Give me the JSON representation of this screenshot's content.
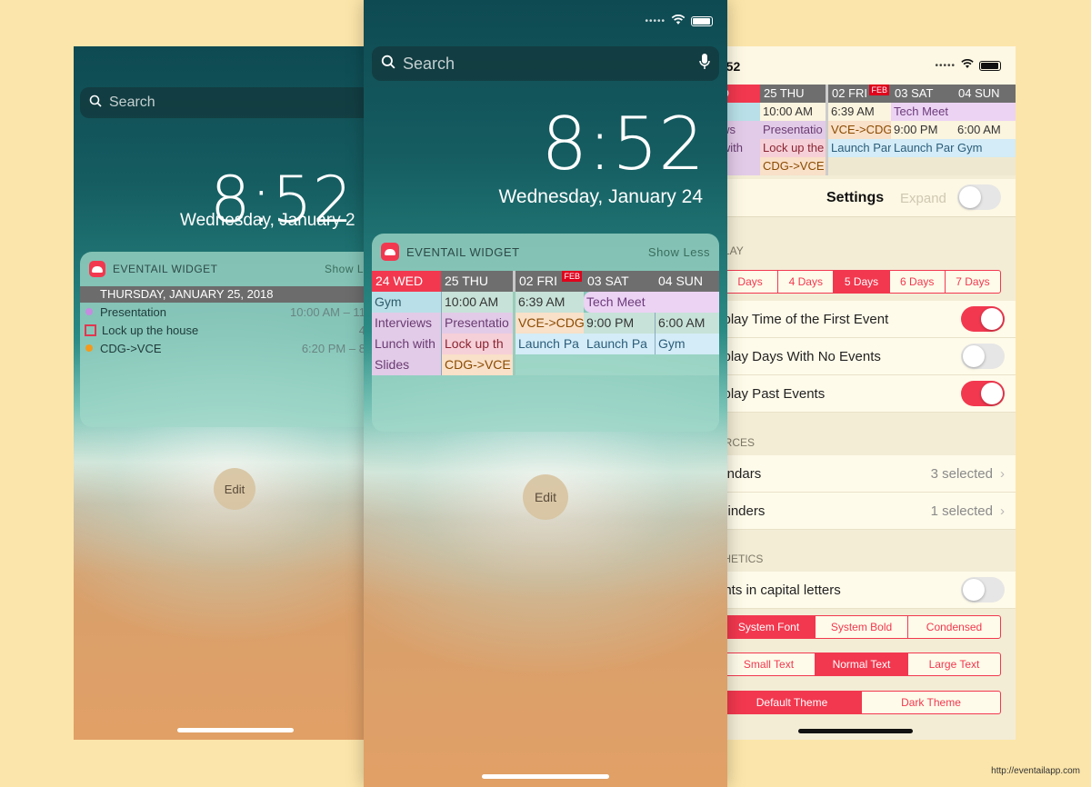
{
  "left": {
    "search": "Search",
    "time": "8:52",
    "date": "Wednesday, January 2",
    "widget": {
      "title": "EVENTAIL WIDGET",
      "action": "Show L",
      "day_header": "THURSDAY, JANUARY 25, 2018",
      "events": [
        {
          "label": "Presentation",
          "time": "10:00 AM – 11:00",
          "marker": "dot",
          "color": "#c58be0"
        },
        {
          "label": "Lock up the house",
          "time": "4:00",
          "marker": "square",
          "color": "#e2374f"
        },
        {
          "label": "CDG->VCE",
          "time": "6:20 PM – 8:00",
          "marker": "dot",
          "color": "#f39a1c"
        }
      ]
    },
    "edit": "Edit"
  },
  "middle": {
    "search": "Search",
    "time": "8:52",
    "date": "Wednesday, January 24",
    "widget": {
      "title": "EVENTAIL WIDGET",
      "action": "Show Less",
      "headers": [
        "24 WED",
        "25 THU",
        "02 FRI",
        "03 SAT",
        "04 SUN"
      ],
      "badge": "FEB",
      "col_wed": [
        "Gym",
        "Interviews",
        "Lunch with",
        "Slides"
      ],
      "col_thu": [
        "10:00 AM",
        "Presentatio",
        "Lock up th",
        "CDG->VCE"
      ],
      "col_fri": [
        "6:39 AM",
        "VCE->CDG",
        "Launch Pa"
      ],
      "tech_meet": "Tech Meet",
      "col_sat": [
        "9:00 PM",
        "Launch Pa"
      ],
      "col_sun": [
        "6:00 AM",
        "Gym"
      ]
    },
    "edit": "Edit"
  },
  "right": {
    "time": ":52",
    "mini": {
      "headers": [
        "ED",
        "25 THU",
        "02 FRI",
        "03 SAT",
        "04 SUN"
      ],
      "badge": "FEB",
      "col_wed": [
        "",
        "iews",
        "n with",
        "s"
      ],
      "col_thu": [
        "10:00 AM",
        "Presentatio",
        "Lock up the",
        "CDG->VCE"
      ],
      "col_fri": [
        "6:39 AM",
        "VCE->CDG",
        "Launch Par"
      ],
      "tech_meet": "Tech Meet",
      "col_sat": [
        "9:00 PM",
        "Launch Par"
      ],
      "col_sun": [
        "6:00 AM",
        "Gym"
      ]
    },
    "nav": {
      "title": "Settings",
      "expand": "Expand"
    },
    "sections": {
      "display": "PLAY",
      "sources": "URCES",
      "aesthetics": "THETICS"
    },
    "days_options": [
      "Days",
      "4 Days",
      "5 Days",
      "6 Days",
      "7 Days"
    ],
    "days_selected": "5 Days",
    "display_rows": [
      {
        "label": "splay Time of the First Event",
        "on": true
      },
      {
        "label": "splay Days With No Events",
        "on": false
      },
      {
        "label": "splay Past Events",
        "on": true
      }
    ],
    "source_rows": [
      {
        "label": "lendars",
        "value": "3 selected"
      },
      {
        "label": "minders",
        "value": "1 selected"
      }
    ],
    "capital_row": {
      "label": "ents in capital letters",
      "on": false
    },
    "font_options": [
      "System Font",
      "System Bold",
      "Condensed"
    ],
    "size_options": [
      "Small Text",
      "Normal Text",
      "Large Text"
    ],
    "theme_options": [
      "Default Theme",
      "Dark Theme"
    ]
  },
  "footer_url": "http://eventailapp.com",
  "colors": {
    "accent": "#f2384f",
    "background": "#fbe5aa"
  }
}
